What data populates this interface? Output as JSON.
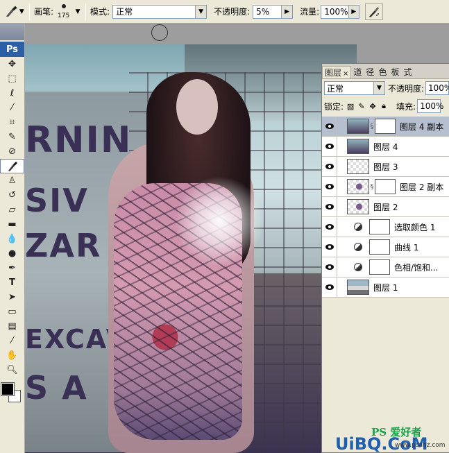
{
  "options_bar": {
    "brush_label": "画笔:",
    "brush_size": "175",
    "mode_label": "模式:",
    "mode_value": "正常",
    "opacity_label": "不透明度:",
    "opacity_value": "5%",
    "flow_label": "流量:",
    "flow_value": "100%"
  },
  "toolbox": {
    "logo": "Ps",
    "foreground_color": "#000000",
    "background_color": "#ffffff"
  },
  "layers_panel": {
    "tabs": [
      {
        "label": "图层",
        "active": true
      },
      {
        "label": "道",
        "active": false
      },
      {
        "label": "径",
        "active": false
      },
      {
        "label": "色",
        "active": false
      },
      {
        "label": "板",
        "active": false
      },
      {
        "label": "式",
        "active": false
      }
    ],
    "blend_mode": "正常",
    "opacity_label": "不透明度:",
    "opacity_value": "100%",
    "lock_label": "锁定:",
    "fill_label": "填充:",
    "fill_value": "100%",
    "layers": [
      {
        "name": "图层 4 副本",
        "selected": true,
        "type": "photo-mask"
      },
      {
        "name": "图层 4",
        "selected": false,
        "type": "photo"
      },
      {
        "name": "图层 3",
        "selected": false,
        "type": "transparent"
      },
      {
        "name": "图层 2 副本",
        "selected": false,
        "type": "figure-mask"
      },
      {
        "name": "图层 2",
        "selected": false,
        "type": "figure"
      },
      {
        "name": "选取颜色 1",
        "selected": false,
        "type": "adjustment"
      },
      {
        "name": "曲线 1",
        "selected": false,
        "type": "adjustment"
      },
      {
        "name": "色相/饱和...",
        "selected": false,
        "type": "adjustment"
      },
      {
        "name": "图层 1",
        "selected": false,
        "type": "base"
      }
    ]
  },
  "canvas": {
    "sign_lines": [
      "RNIN",
      "SIV",
      "ZAR",
      "EXCAVA",
      "S A"
    ]
  },
  "watermark": {
    "ps_text": "PS 爱好者",
    "site": "UiBQ.CoM",
    "url": "www.psahz.com"
  }
}
